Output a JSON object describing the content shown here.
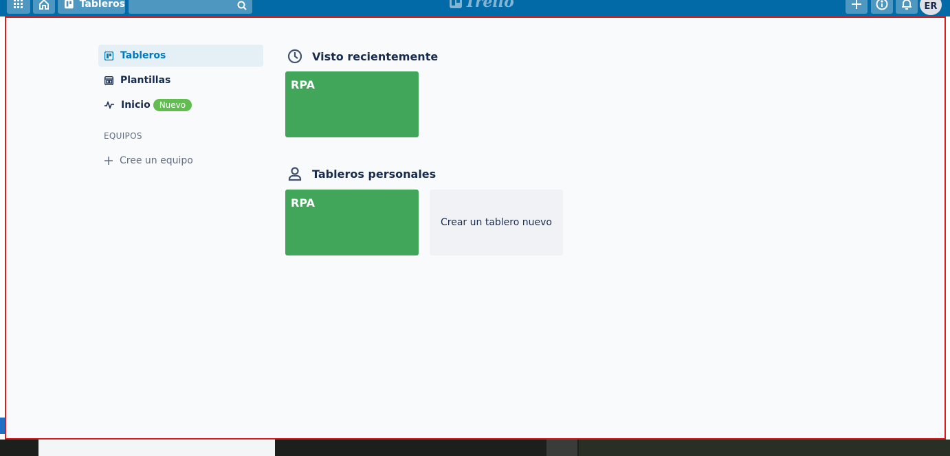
{
  "topbar": {
    "boards_label": "Tableros",
    "logo_text": "Trello",
    "avatar_initials": "ER"
  },
  "sidebar": {
    "items": [
      {
        "label": "Tableros",
        "icon": "board-icon",
        "active": true
      },
      {
        "label": "Plantillas",
        "icon": "template-icon",
        "active": false
      },
      {
        "label": "Inicio",
        "icon": "activity-icon",
        "active": false,
        "badge": "Nuevo"
      }
    ],
    "teams_heading": "EQUIPOS",
    "create_team_label": "Cree un equipo"
  },
  "main": {
    "recent": {
      "title": "Visto recientemente",
      "icon": "clock-icon",
      "boards": [
        {
          "name": "RPA",
          "color": "#41a65a"
        }
      ]
    },
    "personal": {
      "title": "Tableros personales",
      "icon": "person-icon",
      "boards": [
        {
          "name": "RPA",
          "color": "#41a65a"
        }
      ],
      "create_label": "Crear un tablero nuevo"
    }
  },
  "colors": {
    "header": "#026aa7",
    "accent": "#0079bf",
    "frame_border": "#e01b1b",
    "badge": "#61bd4f"
  }
}
